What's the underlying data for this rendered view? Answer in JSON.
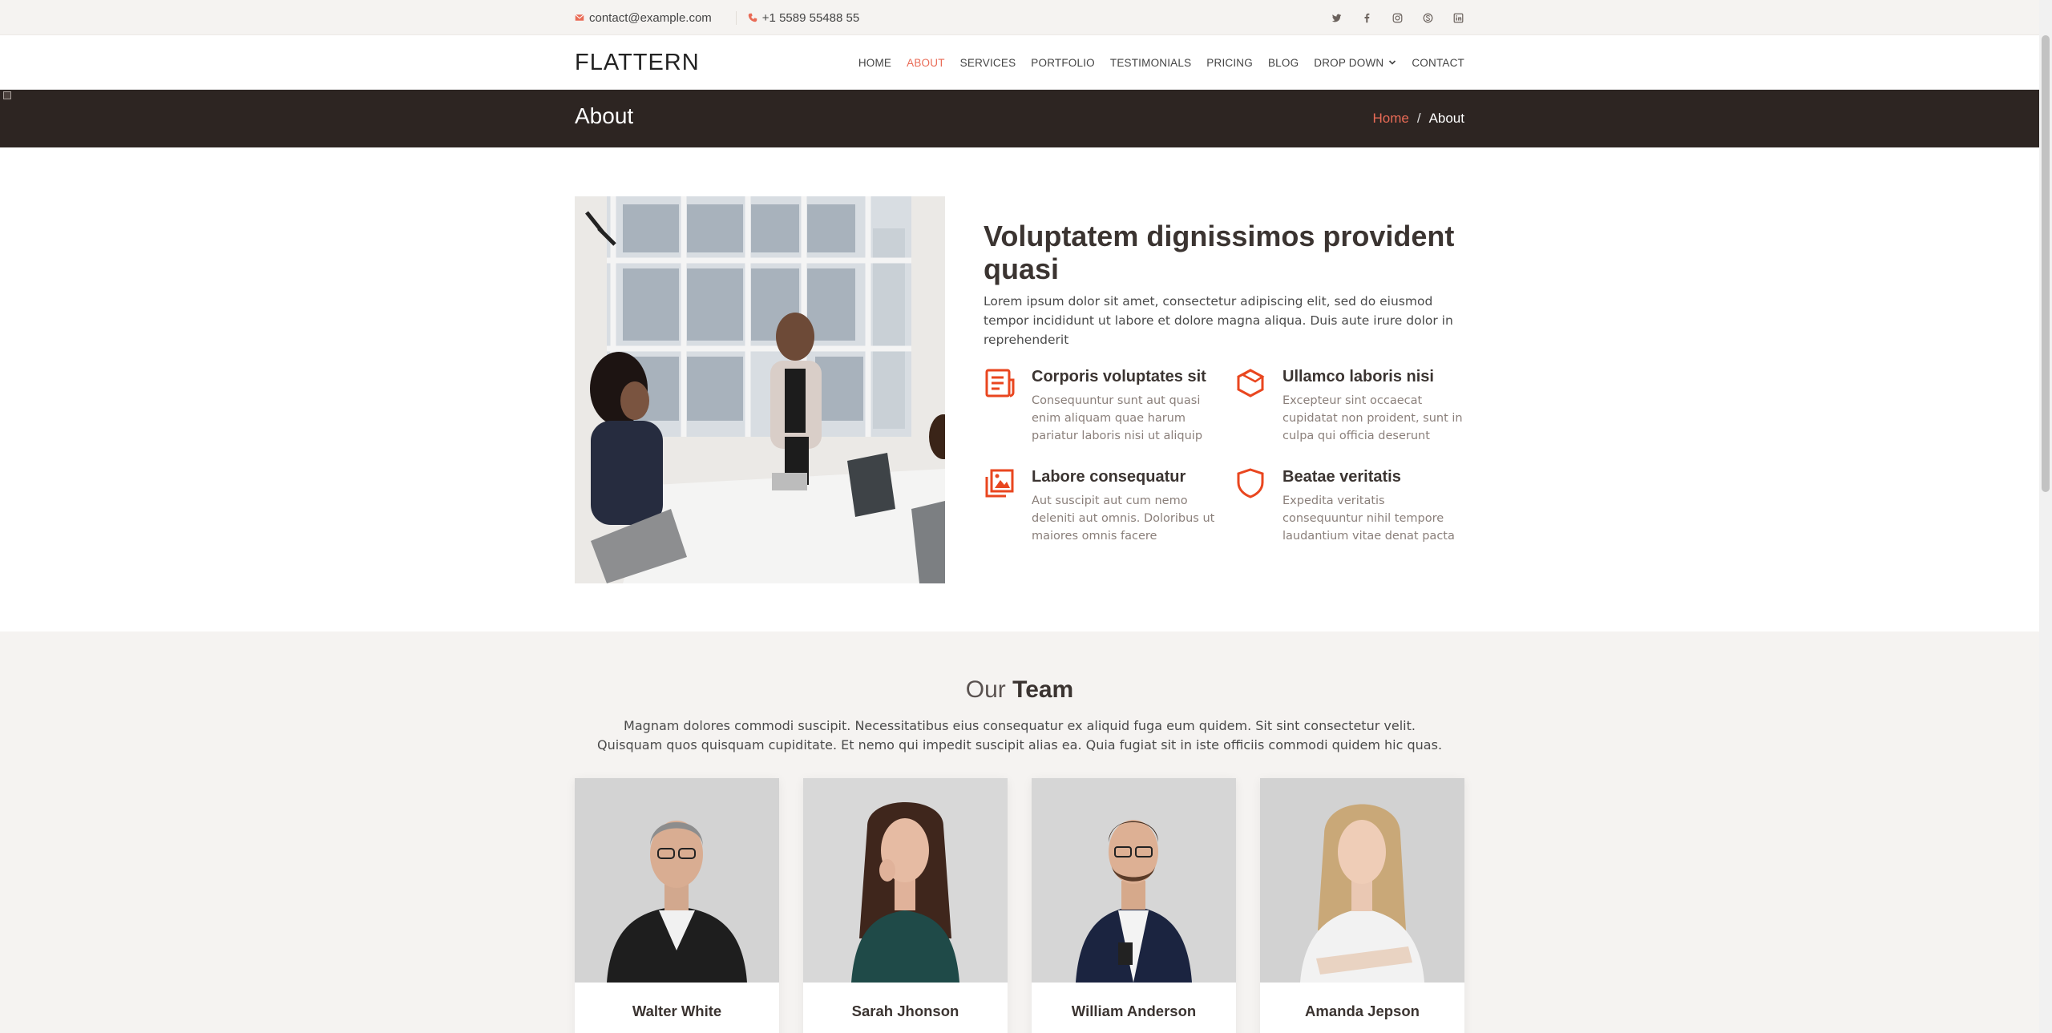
{
  "topbar": {
    "email": "contact@example.com",
    "phone": "+1 5589 55488 55",
    "social": [
      "twitter-icon",
      "facebook-icon",
      "instagram-icon",
      "skype-icon",
      "linkedin-icon"
    ]
  },
  "header": {
    "logo": "FLATTERN",
    "nav": [
      {
        "label": "HOME",
        "active": false
      },
      {
        "label": "ABOUT",
        "active": true
      },
      {
        "label": "SERVICES",
        "active": false
      },
      {
        "label": "PORTFOLIO",
        "active": false
      },
      {
        "label": "TESTIMONIALS",
        "active": false
      },
      {
        "label": "PRICING",
        "active": false
      },
      {
        "label": "BLOG",
        "active": false
      },
      {
        "label": "DROP DOWN",
        "active": false,
        "dropdown": true
      },
      {
        "label": "CONTACT",
        "active": false
      }
    ]
  },
  "breadcrumbs": {
    "title": "About",
    "home": "Home",
    "separator": "/",
    "current": "About"
  },
  "about": {
    "heading": "Voluptatem dignissimos provident quasi",
    "lead": "Lorem ipsum dolor sit amet, consectetur adipiscing elit, sed do eiusmod tempor incididunt ut labore et dolore magna aliqua. Duis aute irure dolor in reprehenderit",
    "features": [
      {
        "icon": "receipt-icon",
        "title": "Corporis voluptates sit",
        "text": "Consequuntur sunt aut quasi enim aliquam quae harum pariatur laboris nisi ut aliquip"
      },
      {
        "icon": "cube-icon",
        "title": "Ullamco laboris nisi",
        "text": "Excepteur sint occaecat cupidatat non proident, sunt in culpa qui officia deserunt"
      },
      {
        "icon": "images-icon",
        "title": "Labore consequatur",
        "text": "Aut suscipit aut cum nemo deleniti aut omnis. Doloribus ut maiores omnis facere"
      },
      {
        "icon": "shield-icon",
        "title": "Beatae veritatis",
        "text": "Expedita veritatis consequuntur nihil tempore laudantium vitae denat pacta"
      }
    ]
  },
  "team": {
    "title_light": "Our",
    "title_bold": "Team",
    "intro": "Magnam dolores commodi suscipit. Necessitatibus eius consequatur ex aliquid fuga eum quidem. Sit sint consectetur velit. Quisquam quos quisquam cupiditate. Et nemo qui impedit suscipit alias ea. Quia fugiat sit in iste officiis commodi quidem hic quas.",
    "members": [
      {
        "name": "Walter White"
      },
      {
        "name": "Sarah Jhonson"
      },
      {
        "name": "William Anderson"
      },
      {
        "name": "Amanda Jepson"
      }
    ]
  },
  "colors": {
    "accent": "#e96b56",
    "dark_band": "#2d2522",
    "topbar_bg": "#f5f3f1"
  }
}
